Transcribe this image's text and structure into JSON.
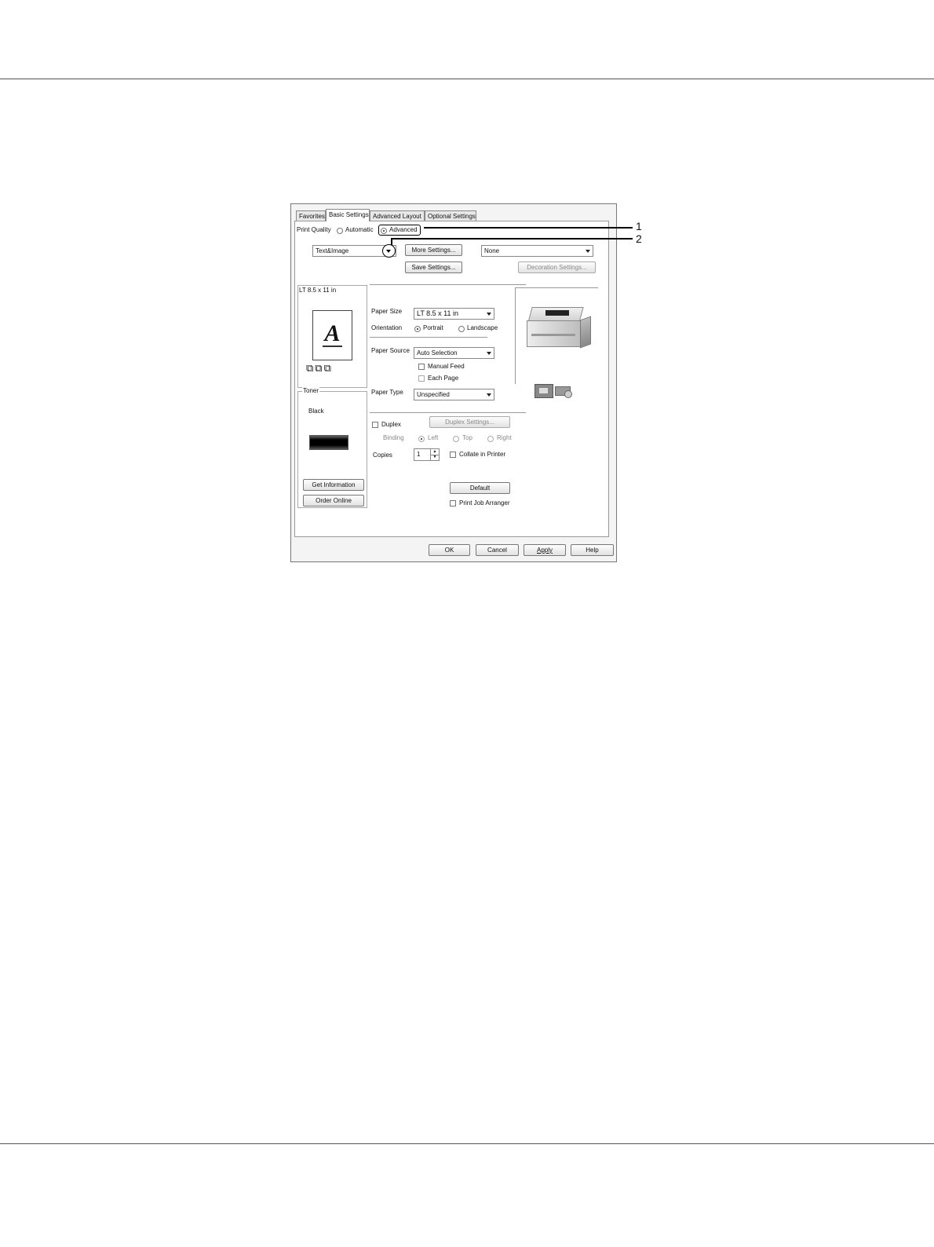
{
  "dialog": {
    "tabs": [
      "Favorites",
      "Basic Settings",
      "Advanced Layout",
      "Optional Settings"
    ],
    "active_tab": "Basic Settings",
    "print_quality": {
      "label": "Print Quality",
      "options": [
        "Automatic",
        "Advanced"
      ],
      "selected": "Advanced",
      "preset_value": "Text&Image"
    },
    "buttons": {
      "more_settings": "More Settings...",
      "save_settings": "Save Settings...",
      "decoration_settings": "Decoration Settings...",
      "duplex_settings": "Duplex Settings...",
      "get_information": "Get Information",
      "order_online": "Order Online",
      "default": "Default",
      "ok": "OK",
      "cancel": "Cancel",
      "apply": "Apply",
      "help": "Help"
    },
    "watermark_value": "None",
    "preview": {
      "paper_label": "LT 8.5 x 11 in",
      "letter": "A"
    },
    "paper_size": {
      "label": "Paper Size",
      "value": "LT 8.5 x 11 in"
    },
    "orientation": {
      "label": "Orientation",
      "options": [
        "Portrait",
        "Landscape"
      ],
      "selected": "Portrait"
    },
    "paper_source": {
      "label": "Paper Source",
      "value": "Auto Selection"
    },
    "manual_feed": {
      "label": "Manual Feed",
      "checked": false
    },
    "each_page": {
      "label": "Each Page",
      "checked": false
    },
    "paper_type": {
      "label": "Paper Type",
      "value": "Unspecified"
    },
    "toner": {
      "group_label": "Toner",
      "color_label": "Black"
    },
    "duplex": {
      "label": "Duplex",
      "checked": false
    },
    "binding": {
      "label": "Binding",
      "options": [
        "Left",
        "Top",
        "Right"
      ],
      "selected": "Left"
    },
    "copies": {
      "label": "Copies",
      "value": "1"
    },
    "collate": {
      "label": "Collate in Printer",
      "checked": false
    },
    "print_job_arranger": {
      "label": "Print Job Arranger",
      "checked": false
    }
  },
  "callouts": [
    "1",
    "2"
  ]
}
